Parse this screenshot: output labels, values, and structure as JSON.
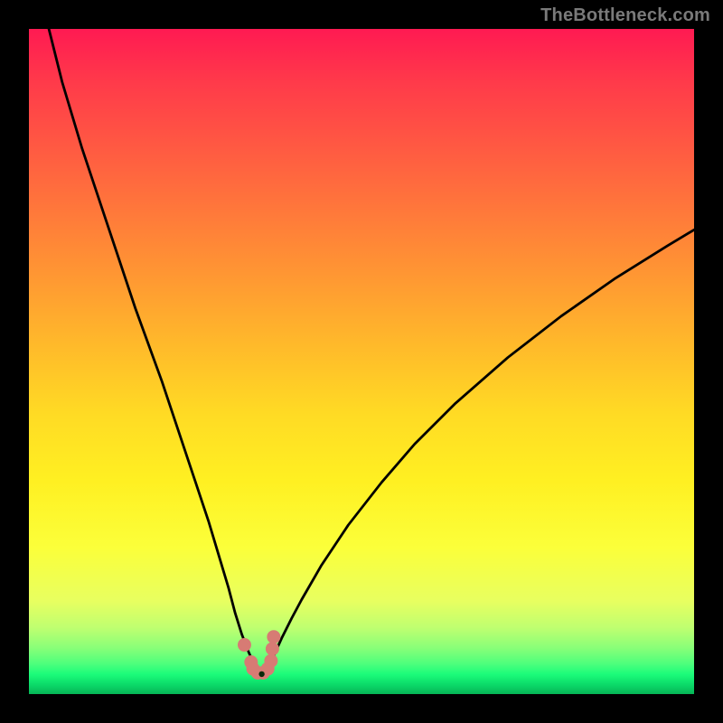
{
  "watermark": "TheBottleneck.com",
  "chart_data": {
    "type": "line",
    "title": "",
    "xlabel": "",
    "ylabel": "",
    "xlim": [
      0,
      100
    ],
    "ylim": [
      0,
      100
    ],
    "grid": false,
    "x": [
      3,
      5,
      8,
      12,
      16,
      20,
      23,
      25,
      27,
      28.5,
      30,
      31,
      32,
      33,
      33.8,
      34.4,
      35,
      35.6,
      36.2,
      37,
      38,
      39.5,
      41,
      44,
      48,
      53,
      58,
      64,
      72,
      80,
      88,
      96,
      100
    ],
    "values": [
      100,
      92,
      82,
      70,
      58,
      47,
      38,
      32,
      26,
      21,
      16,
      12.2,
      9,
      6.4,
      4.6,
      3.5,
      3.0,
      3.4,
      4.4,
      6.2,
      8.4,
      11.4,
      14.2,
      19.4,
      25.4,
      31.8,
      37.6,
      43.6,
      50.6,
      56.8,
      62.4,
      67.4,
      69.8
    ],
    "markers": {
      "x": [
        32.4,
        33.4,
        33.7,
        34.4,
        35.2,
        35.9,
        36.4,
        36.6,
        36.8
      ],
      "y": [
        7.4,
        4.8,
        3.8,
        3.2,
        3.2,
        3.8,
        5.0,
        6.8,
        8.6
      ]
    },
    "min_point": {
      "x": 35.0,
      "y": 3.0
    },
    "background_gradient": {
      "top": "#ff1a52",
      "mid": "#ffdb24",
      "bottom": "#06b556"
    },
    "annotations": []
  }
}
